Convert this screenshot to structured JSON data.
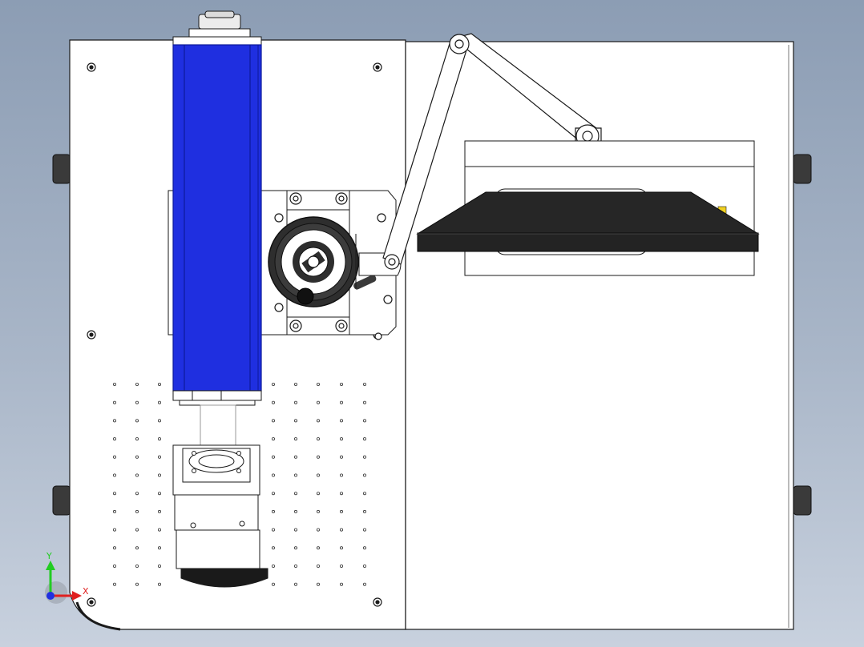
{
  "colors": {
    "background_top": "#8c9db4",
    "background_bottom": "#c8d1de",
    "plate": "#ffffff",
    "outline": "#1a1a1a",
    "laser_tube": "#1f2fe0",
    "laser_tube_dark": "#0d1a9a",
    "monitor": "#262626",
    "handle": "#3a3a3a",
    "axis_y": "#22cc22",
    "axis_x": "#e02020",
    "axis_z": "#2030e0"
  },
  "axis_triad": {
    "y_label": "Y",
    "x_label": "X"
  },
  "icons": [
    "axis-triad-icon",
    "handwheel-icon"
  ]
}
